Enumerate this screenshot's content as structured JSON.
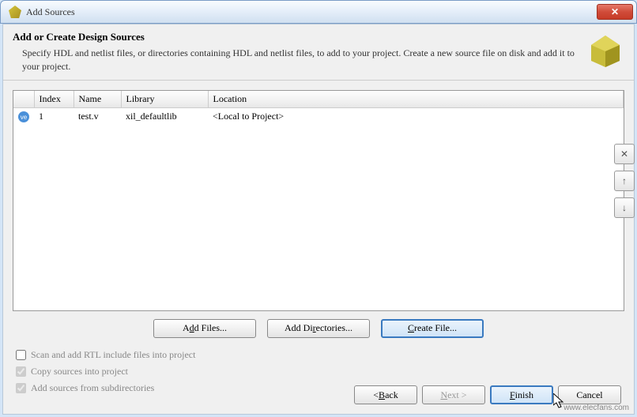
{
  "window": {
    "title": "Add Sources",
    "close": "✕"
  },
  "header": {
    "title": "Add or Create Design Sources",
    "description": "Specify HDL and netlist files, or directories containing HDL and netlist files, to add to your project. Create a new source file on disk and add it to your project."
  },
  "table": {
    "columns": [
      "",
      "Index",
      "Name",
      "Library",
      "Location"
    ],
    "rows": [
      {
        "icon": "ve",
        "index": "1",
        "name": "test.v",
        "library": "xil_defaultlib",
        "location": "<Local to Project>"
      }
    ]
  },
  "side": {
    "remove": "✕",
    "up": "↑",
    "down": "↓"
  },
  "actions": {
    "add_files_pre": "A",
    "add_files_u": "d",
    "add_files_post": "d Files...",
    "add_dirs_pre": "Add Di",
    "add_dirs_u": "r",
    "add_dirs_post": "ectories...",
    "create_pre": "",
    "create_u": "C",
    "create_post": "reate File..."
  },
  "checks": {
    "scan": "Scan and add RTL include files into project",
    "copy": "Copy sources into project",
    "subdirs": "Add sources from subdirectories"
  },
  "footer": {
    "back_pre": "< ",
    "back_u": "B",
    "back_post": "ack",
    "next_pre": "",
    "next_u": "N",
    "next_post": "ext >",
    "finish_pre": "",
    "finish_u": "F",
    "finish_post": "inish",
    "cancel": "Cancel"
  },
  "watermark": "www.elecfans.com"
}
